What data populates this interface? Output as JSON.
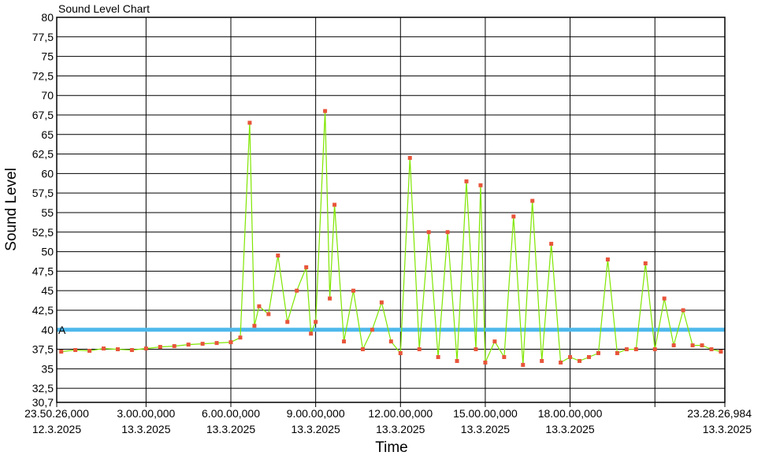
{
  "chart_data": {
    "type": "line",
    "title": "Sound Level Chart",
    "xlabel": "Time",
    "ylabel": "Sound Level",
    "ylim": [
      30.7,
      80
    ],
    "xlim": [
      "2025-03-12T23:50:26",
      "2025-03-13T23:28:26.984"
    ],
    "grid": true,
    "y_ticks": [
      "30,7",
      "32,5",
      "35",
      "37,5",
      "40",
      "42,5",
      "45",
      "47,5",
      "50",
      "52,5",
      "55",
      "57,5",
      "60",
      "62,5",
      "65",
      "67,5",
      "70",
      "72,5",
      "75",
      "77,5",
      "80"
    ],
    "x_ticks": [
      {
        "time": "23.50.26,000",
        "date": "12.3.2025"
      },
      {
        "time": "3.00.00,000",
        "date": "13.3.2025"
      },
      {
        "time": "6.00.00,000",
        "date": "13.3.2025"
      },
      {
        "time": "9.00.00,000",
        "date": "13.3.2025"
      },
      {
        "time": "12.00.00,000",
        "date": "13.3.2025"
      },
      {
        "time": "15.00.00,000",
        "date": "13.3.2025"
      },
      {
        "time": "18.00.00,000",
        "date": "13.3.2025"
      },
      {
        "time": "",
        "date": ""
      },
      {
        "time": "23.28.26,984",
        "date": "13.3.2025"
      }
    ],
    "threshold": {
      "label": "A",
      "value": 40,
      "color": "#4db8ec"
    },
    "series": [
      {
        "name": "",
        "line_color": "#7fe600",
        "marker_color": "#e8553a",
        "x": [
          "00:00",
          "00:30",
          "01:00",
          "01:30",
          "02:00",
          "02:30",
          "03:00",
          "03:30",
          "04:00",
          "04:30",
          "05:00",
          "05:30",
          "06:00",
          "06:20",
          "06:40",
          "06:50",
          "07:00",
          "07:20",
          "07:40",
          "08:00",
          "08:20",
          "08:40",
          "08:50",
          "09:00",
          "09:20",
          "09:30",
          "09:40",
          "10:00",
          "10:20",
          "10:40",
          "11:00",
          "11:20",
          "11:40",
          "12:00",
          "12:20",
          "12:40",
          "13:00",
          "13:20",
          "13:40",
          "14:00",
          "14:20",
          "14:40",
          "14:50",
          "15:00",
          "15:20",
          "15:40",
          "16:00",
          "16:20",
          "16:40",
          "17:00",
          "17:20",
          "17:40",
          "18:00",
          "18:20",
          "18:40",
          "19:00",
          "19:20",
          "19:40",
          "20:00",
          "20:20",
          "20:40",
          "21:00",
          "21:20",
          "21:40",
          "22:00",
          "22:20",
          "22:40",
          "23:00",
          "23:20"
        ],
        "values": [
          37.2,
          37.4,
          37.3,
          37.6,
          37.5,
          37.4,
          37.6,
          37.8,
          37.9,
          38.1,
          38.2,
          38.3,
          38.4,
          39.0,
          66.5,
          40.5,
          43.0,
          42.0,
          49.5,
          41.0,
          45.0,
          48.0,
          39.5,
          41.0,
          68.0,
          44.0,
          56.0,
          38.5,
          45.0,
          37.5,
          40.0,
          43.5,
          38.5,
          37.0,
          62.0,
          37.5,
          52.5,
          36.5,
          52.5,
          36.0,
          59.0,
          37.5,
          58.5,
          35.8,
          38.5,
          36.5,
          54.5,
          35.5,
          56.5,
          36.0,
          51.0,
          35.8,
          36.5,
          36.0,
          36.5,
          37.0,
          49.0,
          37.0,
          37.5,
          37.5,
          48.5,
          37.5,
          44.0,
          38.0,
          42.5,
          38.0,
          38.0,
          37.5,
          37.2
        ]
      }
    ]
  }
}
